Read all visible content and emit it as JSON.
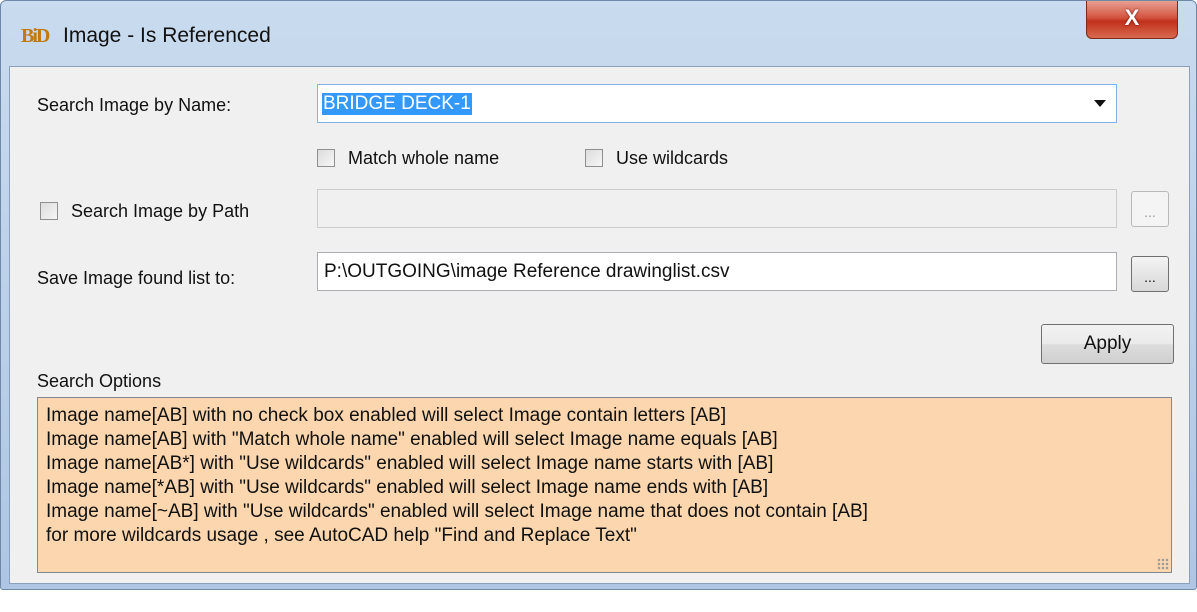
{
  "window": {
    "title": "Image - Is Referenced",
    "app_logo_text": "BiD",
    "close_label": "X"
  },
  "search_name": {
    "label": "Search Image by Name:",
    "value": "BRIDGE DECK-1"
  },
  "options": {
    "match_whole_name": {
      "label": "Match whole name",
      "checked": false
    },
    "use_wildcards": {
      "label": "Use wildcards",
      "checked": false
    }
  },
  "search_path": {
    "label": "Search Image by Path",
    "checked": false,
    "value": "",
    "browse_label": "..."
  },
  "save_list": {
    "label": "Save Image found list to:",
    "value": "P:\\OUTGOING\\image Reference drawinglist.csv",
    "browse_label": "..."
  },
  "apply_label": "Apply",
  "search_options": {
    "heading": "Search Options",
    "lines": [
      "Image name[AB] with no check box enabled will select Image contain letters [AB]",
      "Image name[AB] with \"Match whole name\" enabled will select Image name equals [AB]",
      "Image name[AB*] with \"Use wildcards\" enabled will select Image name starts with [AB]",
      "Image name[*AB] with \"Use wildcards\" enabled will select Image name ends with [AB]",
      "Image name[~AB] with \"Use wildcards\" enabled will select Image name that does not contain [AB]",
      "for more wildcards usage , see AutoCAD help  \"Find and Replace Text\""
    ],
    "background_color": "#fbd6ae"
  }
}
